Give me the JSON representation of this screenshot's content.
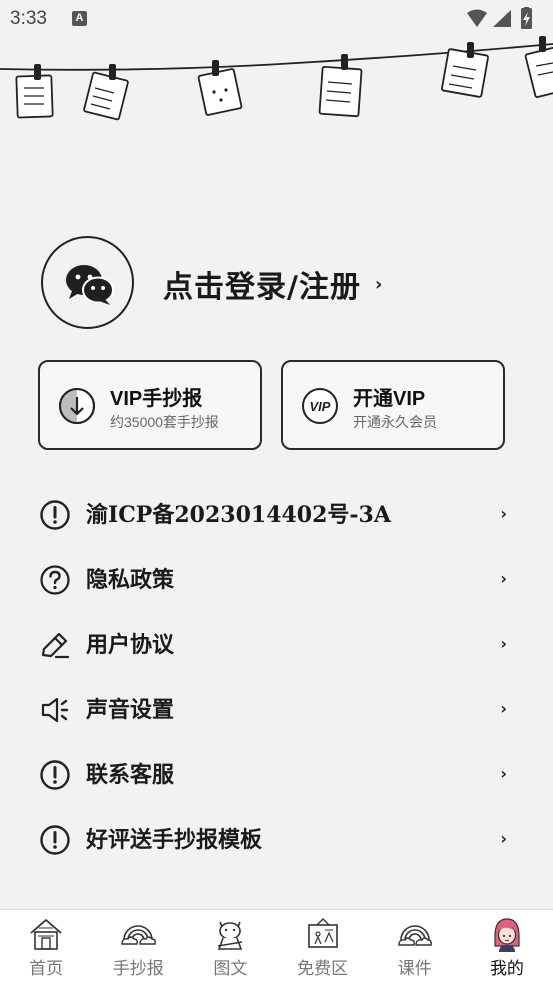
{
  "status_bar": {
    "time": "3:33",
    "notification_badge": "A",
    "icons": [
      "wifi-icon",
      "signal-icon",
      "battery-charging-icon"
    ]
  },
  "profile": {
    "avatar_icon": "wechat-icon",
    "login_label": "点击登录/注册",
    "chevron": "›"
  },
  "cards": [
    {
      "title": "VIP手抄报",
      "subtitle": "约35000套手抄报",
      "icon": "download-icon"
    },
    {
      "title": "开通VIP",
      "subtitle": "开通永久会员",
      "icon": "vip-badge-icon"
    }
  ],
  "menu": [
    {
      "label": "渝ICP备2023014402号-3A",
      "icon": "info-circle-icon"
    },
    {
      "label": "隐私政策",
      "icon": "question-circle-icon"
    },
    {
      "label": "用户协议",
      "icon": "pencil-icon"
    },
    {
      "label": "声音设置",
      "icon": "speaker-icon"
    },
    {
      "label": "联系客服",
      "icon": "info-circle-icon"
    },
    {
      "label": "好评送手抄报模板",
      "icon": "info-circle-icon"
    }
  ],
  "menu_chevron": "›",
  "bottom_nav": [
    {
      "label": "首页",
      "icon": "house-icon",
      "active": false
    },
    {
      "label": "手抄报",
      "icon": "rainbow-icon",
      "active": false
    },
    {
      "label": "图文",
      "icon": "cat-icon",
      "active": false
    },
    {
      "label": "免费区",
      "icon": "chalkboard-icon",
      "active": false
    },
    {
      "label": "课件",
      "icon": "rainbow-cloud-icon",
      "active": false
    },
    {
      "label": "我的",
      "icon": "girl-avatar-icon",
      "active": true
    }
  ],
  "colors": {
    "background": "#f2f2f2",
    "text": "#1a1a1a",
    "nav_inactive": "#777777",
    "nav_active": "#111111",
    "avatar_pink": "#e0607a"
  }
}
